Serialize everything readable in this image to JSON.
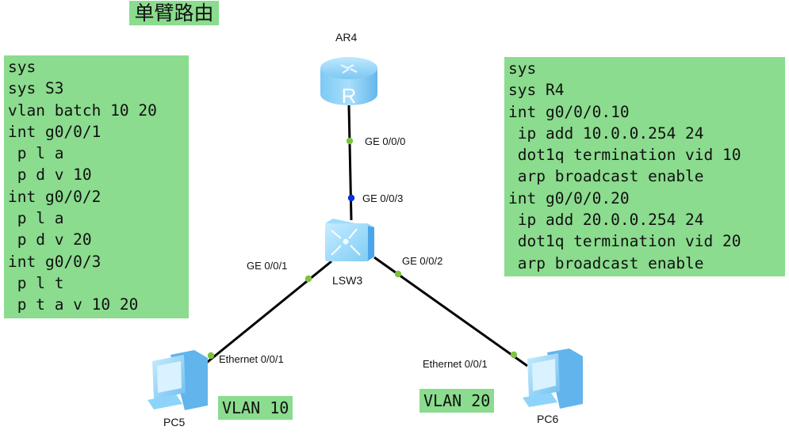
{
  "title": "单臂路由",
  "switch_config": {
    "lines": [
      "sys",
      "sys S3",
      "vlan batch 10 20",
      "int g0/0/1",
      " p l a",
      " p d v 10",
      "int g0/0/2",
      " p l a",
      " p d v 20",
      "int g0/0/3",
      " p l t",
      " p t a v 10 20"
    ]
  },
  "router_config": {
    "lines": [
      "sys",
      "sys R4",
      "int g0/0/0.10",
      " ip add 10.0.0.254 24",
      " dot1q termination vid 10",
      " arp broadcast enable",
      "int g0/0/0.20",
      " ip add 20.0.0.254 24",
      " dot1q termination vid 20",
      " arp broadcast enable"
    ]
  },
  "devices": {
    "router": {
      "name": "AR4",
      "icon": "router-icon"
    },
    "switch": {
      "name": "LSW3",
      "icon": "switch-icon"
    },
    "pc5": {
      "name": "PC5",
      "icon": "pc-icon"
    },
    "pc6": {
      "name": "PC6",
      "icon": "pc-icon"
    }
  },
  "ports": {
    "ar4_ge000": "GE 0/0/0",
    "lsw3_ge003": "GE 0/0/3",
    "lsw3_ge001": "GE 0/0/1",
    "lsw3_ge002": "GE 0/0/2",
    "pc5_eth": "Ethernet 0/0/1",
    "pc6_eth": "Ethernet 0/0/1"
  },
  "vlans": {
    "pc5": "VLAN 10",
    "pc6": "VLAN 20"
  },
  "colors": {
    "box_green": "#8bdc8e",
    "port_up": "#7cc33f",
    "port_blue": "#0a2fe0",
    "link": "#000000"
  }
}
